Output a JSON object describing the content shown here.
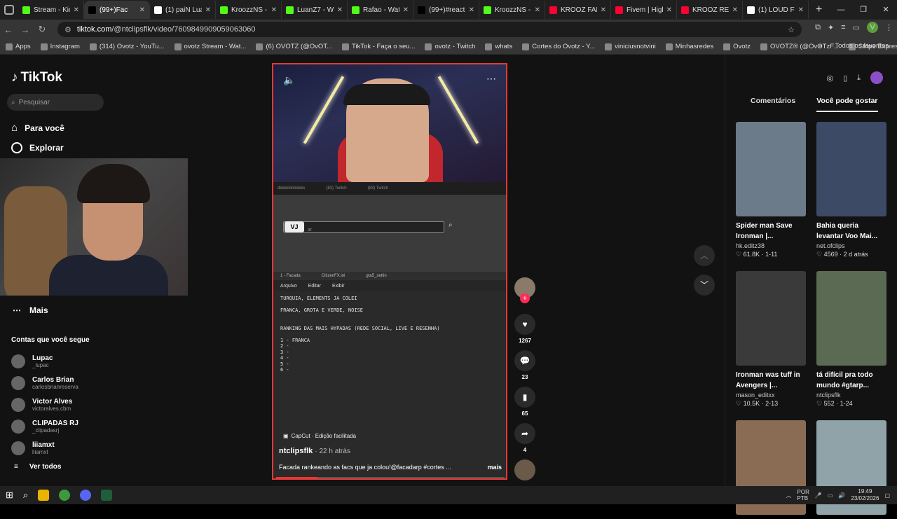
{
  "browser": {
    "tabs": [
      {
        "label": "Stream - Kic",
        "color": "#53fc18"
      },
      {
        "label": "(99+)Fac",
        "color": "#000000",
        "active": true
      },
      {
        "label": "(1) paiN Lua",
        "color": "#ffffff"
      },
      {
        "label": "KroozzNS -",
        "color": "#53fc18"
      },
      {
        "label": "LuanZ7 - Wa",
        "color": "#53fc18"
      },
      {
        "label": "Rafao - Wat",
        "color": "#53fc18"
      },
      {
        "label": "(99+)#react",
        "color": "#000000"
      },
      {
        "label": "KroozzNS -",
        "color": "#53fc18"
      },
      {
        "label": "KROOZ FALA",
        "color": "#ff0033"
      },
      {
        "label": "Fivem | High",
        "color": "#ff0033"
      },
      {
        "label": "KROOZ REA",
        "color": "#ff0033"
      },
      {
        "label": "(1) LOUD Fa",
        "color": "#ffffff"
      }
    ],
    "url_host": "tiktok.com",
    "url_path": "/@ntclipsflk/video/7609849909059063060",
    "bookmarks": [
      "Apps",
      "Instagram",
      "(314) Ovotz - YouTu...",
      "ovotz Stream - Wat...",
      "(6) OVOTZ (@OvOT...",
      "TikTok - Faça o seu...",
      "ovotz - Twitch",
      "whats",
      "Cortes do Ovotz - Y...",
      "viniciusnotvini",
      "Minhasredes",
      "Ovotz",
      "OVOTZ® (@OvOTzF...",
      "Stripe Express"
    ],
    "bookmarks_all": "Todos os favoritos",
    "profile_letter": "V"
  },
  "sidebar": {
    "logo": "TikTok",
    "search_placeholder": "Pesquisar",
    "nav": [
      "Para você",
      "Explorar"
    ],
    "more": "Mais",
    "following_title": "Contas que você segue",
    "accounts": [
      {
        "name": "Lupac",
        "handle": "_lupac"
      },
      {
        "name": "Carlos Brian",
        "handle": "carlosbrianreserva"
      },
      {
        "name": "Victor Alves",
        "handle": "victoralves.cbm"
      },
      {
        "name": "CLIPADAS RJ",
        "handle": "_clipadasrj"
      },
      {
        "name": "liiamxt",
        "handle": "liiamxt"
      }
    ],
    "see_all": "Ver todos"
  },
  "video": {
    "strip": [
      "dkkkkkkkkkkks",
      "(83) Twitch",
      "(83) Twitch"
    ],
    "search_value": "ar",
    "file_tabs": [
      "1 - Facada",
      "CitizenFX.ini",
      "gta5_settin"
    ],
    "menu": [
      "Arquivo",
      "Editar",
      "Exibir"
    ],
    "notepad_text": "TURQUIA, ELEMENTS JA COLEI\n\nFRANCA, GROTA E VERDE, NOISE\n\n\nRANKING DAS MAIS HYPADAS (REDE SOCIAL, LIVE E RESENHA)\n\n1 - FRANCA\n2 -\n3 -\n4 -\n5 -\n6 -",
    "capcut": "CapCut · Edição facilitada",
    "author": "ntclipsflk",
    "time": "· 22 h atrás",
    "caption": "Facada rankeando as facs que ja colou!@facadarp #cortes ...",
    "more": "mais",
    "progress": 0.18
  },
  "actions": {
    "likes": "1267",
    "comments": "23",
    "saves": "65",
    "shares": "4"
  },
  "right": {
    "tabs": [
      "Comentários",
      "Você pode gostar"
    ],
    "cards": [
      {
        "title": "Spider man Save Ironman |...",
        "author": "hk.editz38",
        "stats": "♡ 61.8K · 1-11",
        "color": "#6c7b8a"
      },
      {
        "title": "Bahia queria levantar Voo Mai...",
        "author": "net.ofclips",
        "stats": "♡ 4569 · 2 d atrás",
        "color": "#3d4a66"
      },
      {
        "title": "Ironman was tuff in Avengers |...",
        "author": "mason_editxx",
        "stats": "♡ 10.5K · 2-13",
        "color": "#3a3a3a"
      },
      {
        "title": "tá difícil pra todo mundo #gtarp...",
        "author": "ntclipsflk",
        "stats": "♡ 552 · 1-24",
        "color": "#5b6a52"
      },
      {
        "title": "",
        "author": "",
        "stats": "",
        "color": "#8a6c55"
      },
      {
        "title": "",
        "author": "",
        "stats": "",
        "color": "#8fa3a8"
      }
    ]
  },
  "taskbar": {
    "lang": "POR\nPTB",
    "time": "19:49",
    "date": "23/02/2026"
  }
}
